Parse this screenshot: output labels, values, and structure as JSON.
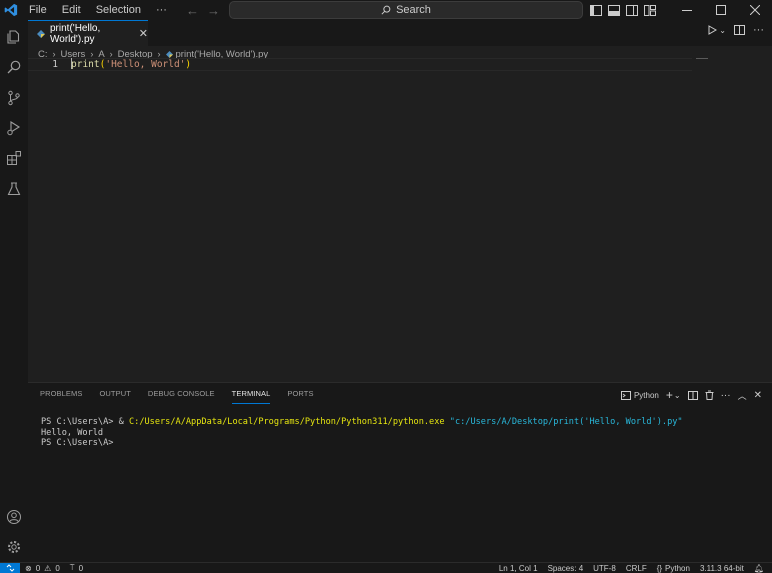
{
  "menu": [
    "File",
    "Edit",
    "Selection",
    "···"
  ],
  "search": {
    "label": "Search"
  },
  "tab": {
    "title": "print('Hello, World').py"
  },
  "breadcrumb": [
    "C:",
    "Users",
    "A",
    "Desktop",
    "print('Hello, World').py"
  ],
  "editor": {
    "line_number": "1",
    "tokens": {
      "fn": "print",
      "open": "(",
      "str": "'Hello, World'",
      "close": ")"
    }
  },
  "panel": {
    "tabs": [
      "PROBLEMS",
      "OUTPUT",
      "DEBUG CONSOLE",
      "TERMINAL",
      "PORTS"
    ],
    "active_tab": "TERMINAL",
    "profile": "Python"
  },
  "terminal": {
    "prompt1": "PS C:\\Users\\A> ",
    "amp": "& ",
    "exe": "C:/Users/A/AppData/Local/Programs/Python/Python311/python.exe",
    "space": " ",
    "arg": "\"c:/Users/A/Desktop/print('Hello, World').py\"",
    "output": "Hello, World",
    "prompt2": "PS C:\\Users\\A>"
  },
  "status": {
    "errors": "0",
    "warnings": "0",
    "ports": "0",
    "position": "Ln 1, Col 1",
    "spaces": "Spaces: 4",
    "encoding": "UTF-8",
    "eol": "CRLF",
    "language": "Python",
    "interpreter": "3.11.3 64-bit"
  },
  "colors": {
    "accent": "#0078d4",
    "background": "#1f1f1f",
    "chrome": "#181818"
  }
}
